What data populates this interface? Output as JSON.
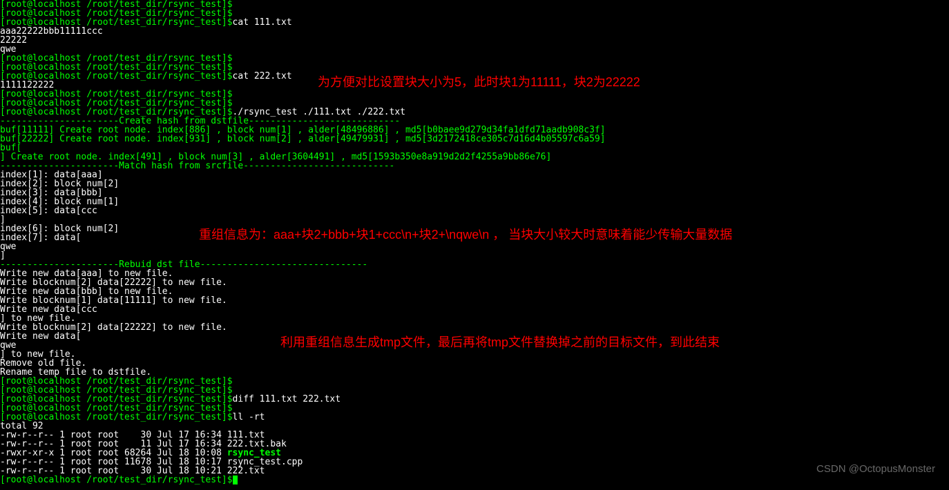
{
  "prompt": "[root@localhost /root/test_dir/rsync_test]$",
  "cmds": {
    "cat111": "cat 111.txt",
    "cat222": "cat 222.txt",
    "run": "./rsync_test ./111.txt ./222.txt",
    "diff": "diff 111.txt 222.txt",
    "ll": "ll -rt"
  },
  "out": {
    "file111_l1": "aaa22222bbb11111ccc",
    "file111_l2": "22222",
    "file111_l3": "qwe",
    "file222_l1": "1111122222",
    "sep_hash": "----------------------Create hash from dstfile----------------------------",
    "buf1": "buf[11111] Create root node. index[886] , block num[1] , alder[48496886] , md5[b0baee9d279d34fa1dfd71aadb908c3f]",
    "buf2": "buf[22222] Create root node. index[931] , block num[2] , alder[49479931] , md5[3d2172418ce305c7d16d4b05597c6a59]",
    "buf3a": "buf[",
    "buf3b": "] Create root node. index[491] , block num[3] , alder[3604491] , md5[1593b350e8a919d2d2f4255a9bb86e76]",
    "sep_match": "----------------------Match hash from srcfile----------------------------",
    "idx1": "index[1]: data[aaa]",
    "idx2": "index[2]: block num[2]",
    "idx3": "index[3]: data[bbb]",
    "idx4": "index[4]: block num[1]",
    "idx5": "index[5]: data[ccc",
    "idx5b": "]",
    "idx6": "index[6]: block num[2]",
    "idx7": "index[7]: data[",
    "idx7b": "qwe",
    "idx7c": "]",
    "sep_rebuild": "----------------------Rebuid dst file-------------------------------",
    "w1": "Write new data[aaa] to new file.",
    "w2": "Write blocknum[2] data[22222] to new file.",
    "w3": "Write new data[bbb] to new file.",
    "w4": "Write blocknum[1] data[11111] to new file.",
    "w5": "Write new data[ccc",
    "w5b": "] to new file.",
    "w6": "Write blocknum[2] data[22222] to new file.",
    "w7": "Write new data[",
    "w7b": "qwe",
    "w7c": "] to new file.",
    "rm": "Remove old file.",
    "rn": "Rename temp file to dstfile.",
    "total": "total 92",
    "ls1": "-rw-r--r-- 1 root root    30 Jul 17 16:34 111.txt",
    "ls2": "-rw-r--r-- 1 root root    11 Jul 17 16:34 222.txt.bak",
    "ls3a": "-rwxr-xr-x 1 root root 68264 Jul 18 10:08 ",
    "ls3b": "rsync_test",
    "ls4": "-rw-r--r-- 1 root root 11678 Jul 18 10:17 rsync_test.cpp",
    "ls5": "-rw-r--r-- 1 root root    30 Jul 18 10:21 222.txt"
  },
  "annotations": {
    "a1": "为方便对比设置块大小为5，此时块1为11111，块2为22222",
    "a2": "重组信息为：aaa+块2+bbb+块1+ccc\\n+块2+\\nqwe\\n   ， 当块大小较大时意味着能少传输大量数据",
    "a3": "利用重组信息生成tmp文件，最后再将tmp文件替换掉之前的目标文件，到此结束"
  },
  "watermark": "CSDN @OctopusMonster"
}
